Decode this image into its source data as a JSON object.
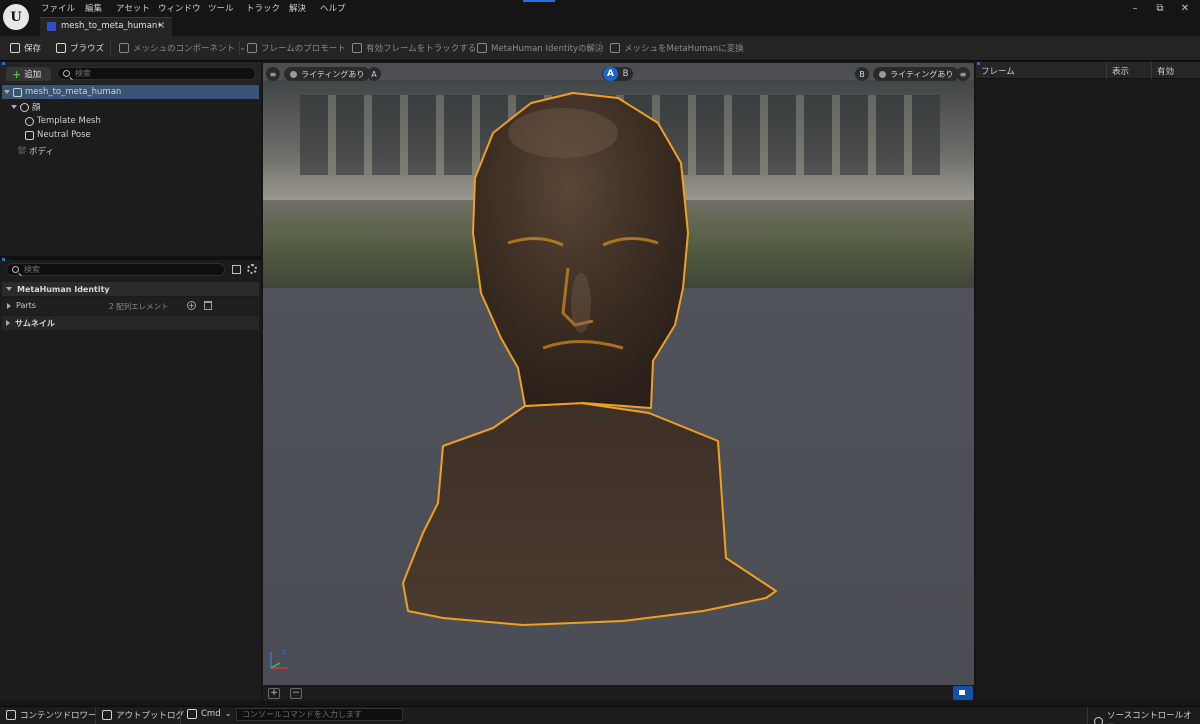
{
  "app": {
    "menu": [
      "ファイル",
      "編集",
      "アセット",
      "ウィンドウ",
      "ツール",
      "トラック",
      "解決",
      "ヘルプ"
    ],
    "logo_glyph": "U"
  },
  "window_controls": {
    "minimize": "–",
    "restore": "⧉",
    "close": "✕"
  },
  "tab": {
    "label": "mesh_to_meta_human•",
    "close": "×"
  },
  "toolbar": {
    "save": "保存",
    "browse": "ブラウズ",
    "mesh_components": "メッシュのコンポーネント",
    "promote_frame": "フレームのプロモート",
    "track_active_frames": "有効フレームをトラックする",
    "identity_solve": "MetaHuman Identityの解決",
    "mesh_to_metahuman": "メッシュをMetaHumanに変換"
  },
  "components_panel": {
    "add_label": "追加",
    "search_placeholder": "検索",
    "tree": [
      {
        "label": "mesh_to_meta_human",
        "selected": true
      },
      {
        "label": "顔"
      },
      {
        "label": "Template Mesh"
      },
      {
        "label": "Neutral Pose"
      },
      {
        "label": "ボディ"
      }
    ]
  },
  "details_panel": {
    "search_placeholder": "検索",
    "section_identity": "MetaHuman Identity",
    "parts_label": "Parts",
    "parts_value": "2 配列エレメント",
    "parts_add": "+",
    "section_thumbnail": "サムネイル"
  },
  "viewport": {
    "left_lighting": "ライティングあり",
    "left_tag": "A",
    "ab_a": "A",
    "ab_b": "B",
    "right_tag": "B",
    "right_lighting": "ライティングあり",
    "zoom_in": "+",
    "zoom_out": "−",
    "axis_z": "Z",
    "selection_outline_color": "#f0a020"
  },
  "frames_panel": {
    "col_frame": "フレーム",
    "col_display": "表示",
    "col_enabled": "有効"
  },
  "statusbar": {
    "content_drawer": "コンテンツドロワー",
    "output_log": "アウトプットログ",
    "cmd": "Cmd",
    "cmd_placeholder": "コンソールコマンドを入力します",
    "source_control": "ソースコントロールオフ"
  },
  "colors": {
    "accent_blue": "#1f65cf",
    "selection_row": "#3a5476",
    "add_green": "#58b845"
  }
}
